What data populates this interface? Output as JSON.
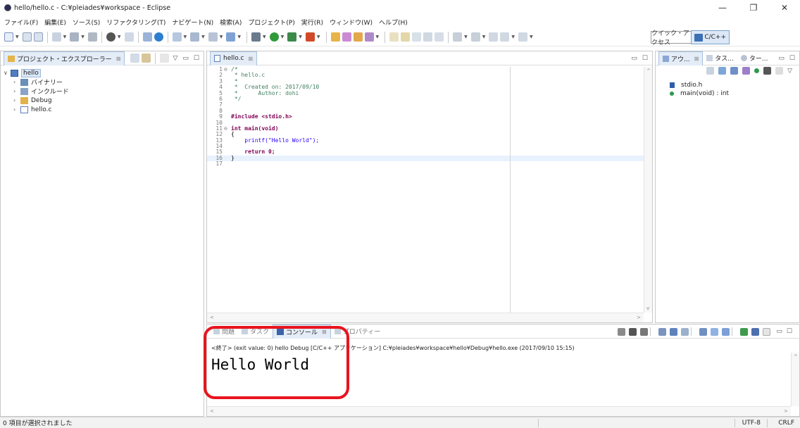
{
  "window": {
    "title": "hello/hello.c - C:¥pleiades¥workspace - Eclipse",
    "minimize_glyph": "—",
    "restore_glyph": "❐",
    "close_glyph": "✕"
  },
  "menu": [
    "ファイル(F)",
    "編集(E)",
    "ソース(S)",
    "リファクタリング(T)",
    "ナビゲート(N)",
    "検索(A)",
    "プロジェクト(P)",
    "実行(R)",
    "ウィンドウ(W)",
    "ヘルプ(H)"
  ],
  "toolbar": {
    "quick_access": "クイック・アクセス",
    "perspective": "C/C++"
  },
  "project_explorer": {
    "tab_label": "プロジェクト・エクスプローラー",
    "tab_close": "⊠",
    "tree": [
      {
        "label": "hello",
        "expanded": "∨",
        "icon": "project-folder-icon"
      },
      {
        "label": "バイナリー",
        "expanded": "›",
        "icon": "binaries-icon"
      },
      {
        "label": "インクルード",
        "expanded": "›",
        "icon": "includes-icon"
      },
      {
        "label": "Debug",
        "expanded": "›",
        "icon": "folder-icon"
      },
      {
        "label": "hello.c",
        "expanded": "›",
        "icon": "c-file-icon"
      }
    ]
  },
  "editor": {
    "tab_label": "hello.c",
    "tab_close": "⊠",
    "lines": [
      {
        "num": "1",
        "fold": "⊖",
        "text": "/*"
      },
      {
        "num": "2",
        "text": " * hello.c"
      },
      {
        "num": "3",
        "text": " *"
      },
      {
        "num": "4",
        "text": " *  Created on: 2017/09/10"
      },
      {
        "num": "5",
        "text": " *      Author: dohi"
      },
      {
        "num": "6",
        "text": " */"
      },
      {
        "num": "7",
        "text": ""
      },
      {
        "num": "8",
        "text": ""
      },
      {
        "num": "9",
        "text": "#include <stdio.h>"
      },
      {
        "num": "10",
        "text": ""
      },
      {
        "num": "11",
        "fold": "⊖",
        "text": "int main(void)"
      },
      {
        "num": "12",
        "text": "{"
      },
      {
        "num": "13",
        "text": "    printf(\"Hello World\");"
      },
      {
        "num": "14",
        "text": ""
      },
      {
        "num": "15",
        "text": "    return 0;"
      },
      {
        "num": "16",
        "text": "}"
      },
      {
        "num": "17",
        "text": ""
      }
    ]
  },
  "outline": {
    "tabs": [
      "アウ...",
      "タス...",
      "ター..."
    ],
    "tab_close": "⊠",
    "items": [
      {
        "label": "stdio.h",
        "icon": "include-icon"
      },
      {
        "label": "main(void) : int",
        "icon": "function-icon"
      }
    ]
  },
  "console": {
    "tabs": [
      "問題",
      "タスク",
      "コンソール",
      "プロパティー"
    ],
    "active_tab": "コンソール",
    "tab_close": "⊠",
    "info": "<終了> (exit value: 0) hello Debug [C/C++ アプリケーション] C:¥pleiades¥workspace¥hello¥Debug¥hello.exe (2017/09/10 15:15)",
    "output": "Hello World"
  },
  "statusbar": {
    "text": "0 項目が選択されました",
    "encoding": "UTF-8",
    "line_ending": "CRLF"
  },
  "colors": {
    "highlight_border": "#e8141e",
    "active_tab_bg": "#e4ecf7"
  }
}
